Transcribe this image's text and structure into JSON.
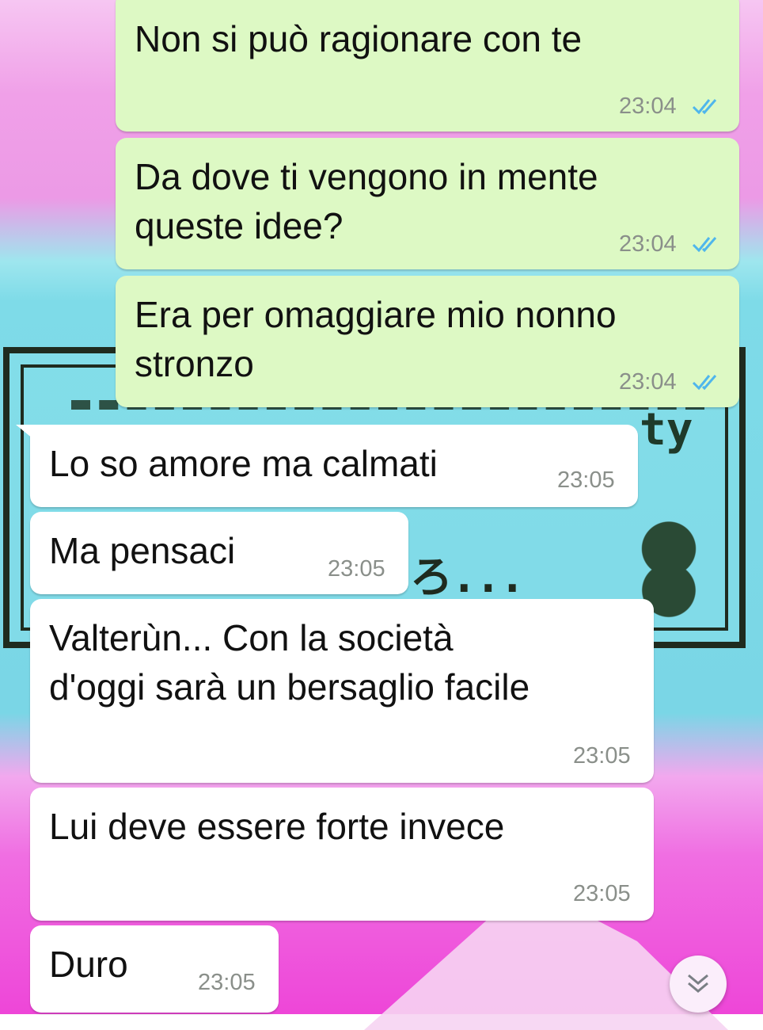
{
  "messages": [
    {
      "text": "Non si può ragionare con te",
      "time": "23:04",
      "status": "read"
    },
    {
      "text": "Da dove ti vengono in mente\nqueste idee?",
      "time": "23:04",
      "status": "read"
    },
    {
      "text": "Era per omaggiare mio nonno\nstronzo",
      "time": "23:04",
      "status": "read"
    },
    {
      "text": "Lo so amore ma calmati",
      "time": "23:05"
    },
    {
      "text": "Ma pensaci",
      "time": "23:05"
    },
    {
      "text": "Valterùn... Con la società\nd'oggi sarà un bersaglio facile",
      "time": "23:05"
    },
    {
      "text": "Lui deve essere forte invece",
      "time": "23:05"
    },
    {
      "text": "Duro",
      "time": "23:05"
    }
  ],
  "colors": {
    "outgoing_bubble": "#ddf9c4",
    "incoming_bubble": "#ffffff",
    "read_ticks": "#4fb6ec",
    "timestamp": "#8a8f8a"
  },
  "icons": {
    "read_receipt": "double-check-icon",
    "scroll_down": "double-chevron-down-icon"
  }
}
